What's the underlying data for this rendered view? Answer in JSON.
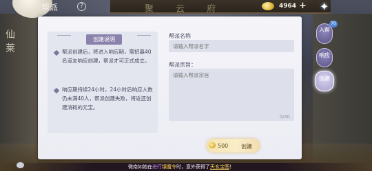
{
  "background": {
    "plaque_text": "聚 云 府",
    "pillar_glyphs": [
      "仙",
      "莱"
    ]
  },
  "header": {
    "title": "帮派",
    "help_icon": "?",
    "currency": {
      "icon": "gold-ingot-icon",
      "amount": "4964"
    },
    "plus_icon": "+",
    "sparkle_icon": "✦"
  },
  "info": {
    "title": "创建说明",
    "paragraphs": [
      "帮派创建后，将进入响应期，需招募40名道友响应创建，帮派才可正式成立。",
      "响应期持续24小时，24小时后响应人数仍未满40人，帮派创建失败，将返还创建消耗的元宝。"
    ]
  },
  "form": {
    "name_label": "帮派名称",
    "name_placeholder": "请输入帮派名字",
    "motto_label": "帮派宗旨：",
    "motto_placeholder": "请输入帮派宗旨",
    "motto_count": "0/40"
  },
  "create_button": {
    "cost": "500",
    "label": "创建"
  },
  "side_tabs": [
    {
      "label": "入帮",
      "badge": "70"
    },
    {
      "label": "响应"
    },
    {
      "label": "创建"
    }
  ],
  "ticker": {
    "part1": "微南如她在",
    "part2": "进行",
    "part3": "镇魔令",
    "part4": "时，意外获得了",
    "part5": "天玄宝图",
    "part6": "！"
  },
  "colors": {
    "accent": "#8a82ac",
    "button": "#f5e3b0",
    "badge": "#4f86d9"
  }
}
